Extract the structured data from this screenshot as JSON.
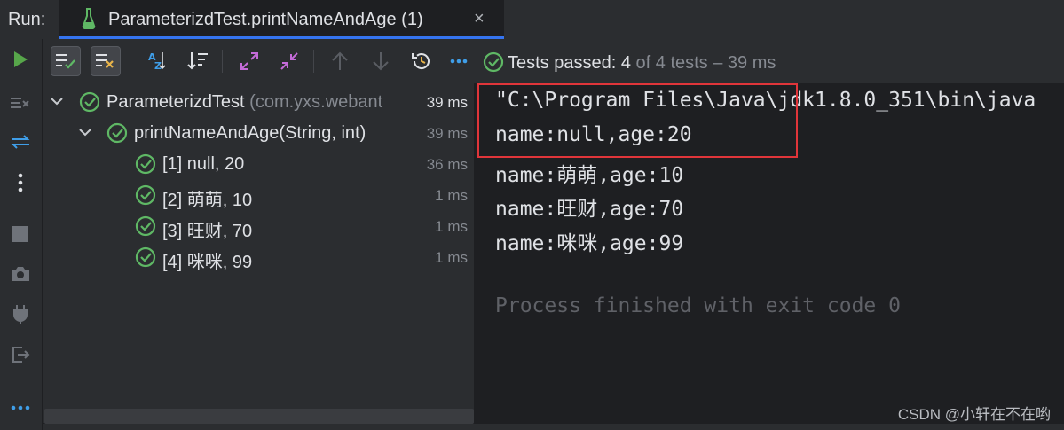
{
  "header": {
    "run_label": "Run:",
    "tab_title": "ParameterizdTest.printNameAndAge (1)",
    "tab_close": "×"
  },
  "status": {
    "prefix": "Tests passed: ",
    "passed": "4",
    "suffix": " of 4 tests – 39 ms"
  },
  "tree": {
    "root": {
      "name": "ParameterizdTest",
      "package": " (com.yxs.webant",
      "duration": "39 ms"
    },
    "method": {
      "name": "printNameAndAge(String, int)",
      "duration": "39 ms"
    },
    "cases": [
      {
        "label": "[1] null, 20",
        "duration": "36 ms"
      },
      {
        "label": "[2] 萌萌, 10",
        "duration": "1 ms"
      },
      {
        "label": "[3] 旺财, 70",
        "duration": "1 ms"
      },
      {
        "label": "[4] 咪咪, 99",
        "duration": "1 ms"
      }
    ]
  },
  "console": {
    "lines": [
      "\"C:\\Program Files\\Java\\jdk1.8.0_351\\bin\\java",
      "name:null,age:20",
      "name:萌萌,age:10",
      "name:旺财,age:70",
      "name:咪咪,age:99"
    ],
    "exit_line": "Process finished with exit code 0"
  },
  "watermark": "CSDN @小轩在不在哟",
  "colors": {
    "accent": "#3574f0",
    "pass_green": "#5fb865",
    "highlight_red": "#e0353a",
    "run_green": "#57a64a"
  }
}
